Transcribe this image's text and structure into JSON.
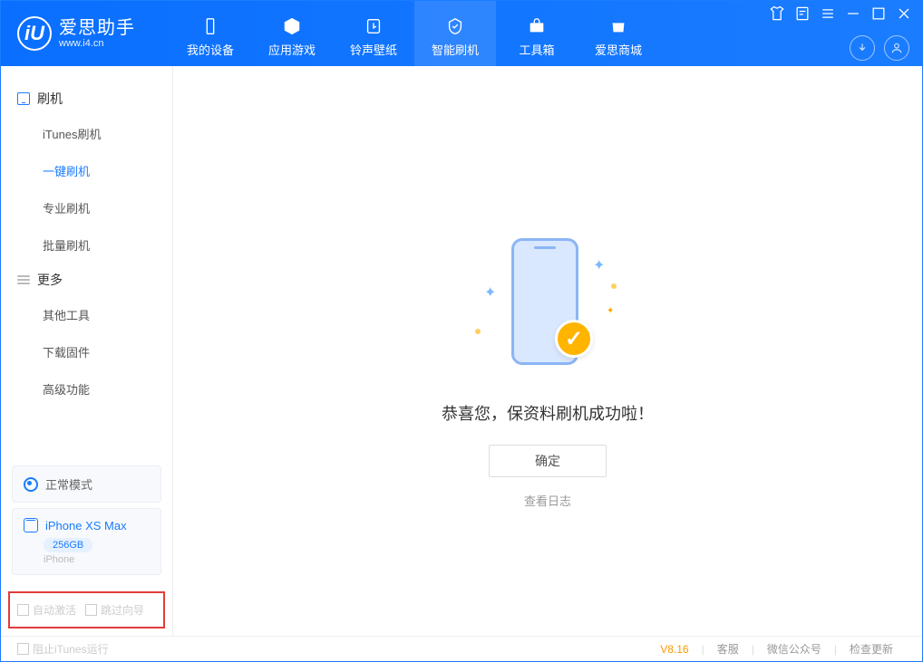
{
  "app": {
    "name_cn": "爱思助手",
    "name_en": "www.i4.cn"
  },
  "tabs": {
    "mydevice": "我的设备",
    "apps": "应用游戏",
    "ringtone": "铃声壁纸",
    "flash": "智能刷机",
    "toolbox": "工具箱",
    "store": "爱思商城"
  },
  "sidebar": {
    "group1": {
      "title": "刷机",
      "items": [
        "iTunes刷机",
        "一键刷机",
        "专业刷机",
        "批量刷机"
      ]
    },
    "group2": {
      "title": "更多",
      "items": [
        "其他工具",
        "下载固件",
        "高级功能"
      ]
    }
  },
  "status": {
    "mode": "正常模式"
  },
  "device": {
    "name": "iPhone XS Max",
    "storage": "256GB",
    "type": "iPhone"
  },
  "redbox": {
    "auto_activate": "自动激活",
    "skip_guide": "跳过向导"
  },
  "main": {
    "success": "恭喜您，保资料刷机成功啦！",
    "ok": "确定",
    "viewlog": "查看日志"
  },
  "footer": {
    "stop_itunes": "阻止iTunes运行",
    "version": "V8.16",
    "support": "客服",
    "wechat": "微信公众号",
    "update": "检查更新"
  }
}
